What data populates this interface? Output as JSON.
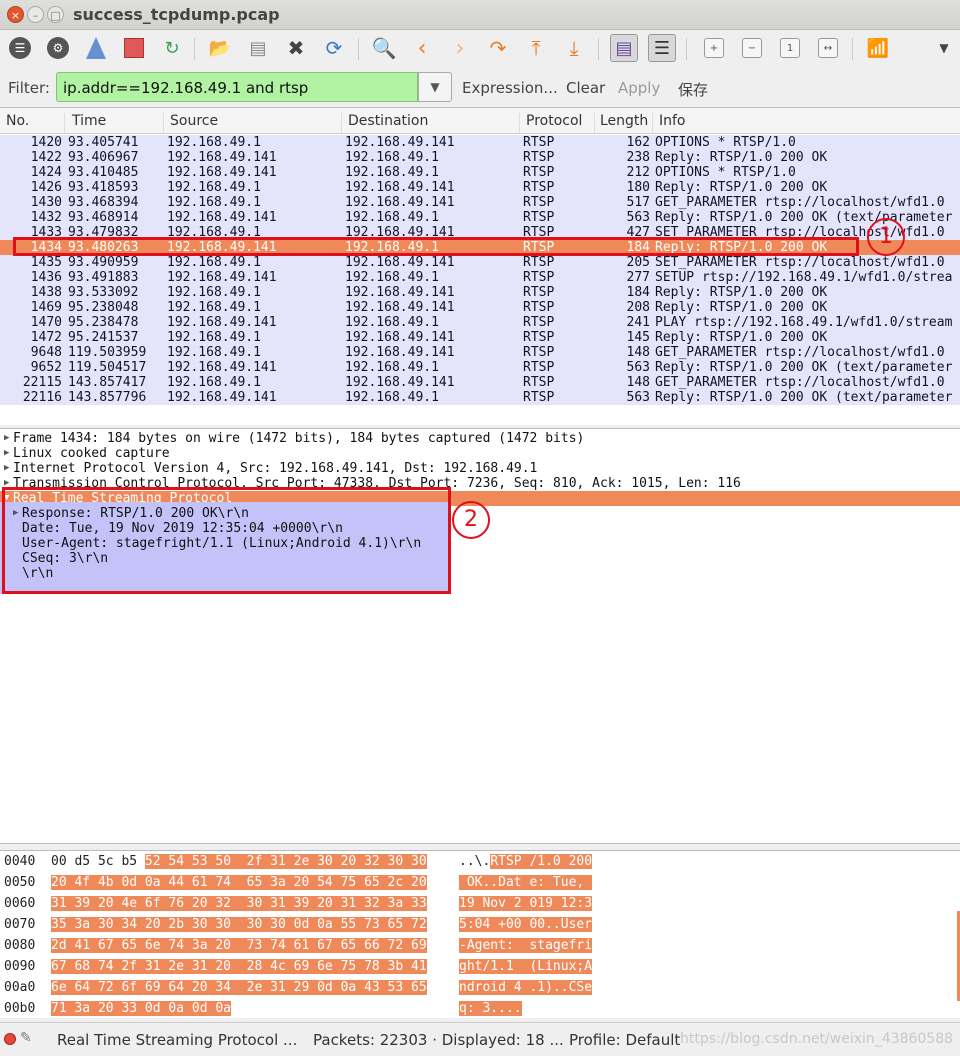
{
  "window": {
    "title": "success_tcpdump.pcap",
    "close_glyph": "×",
    "minimize_glyph": "–",
    "maximize_glyph": "□"
  },
  "toolbar": {
    "icons": [
      "interfaces-icon",
      "options-icon",
      "start-capture-icon",
      "stop-capture-icon",
      "restart-capture-icon",
      "open-file-icon",
      "save-file-icon",
      "close-file-icon",
      "reload-icon",
      "find-packet-icon",
      "go-back-icon",
      "go-forward-icon",
      "go-to-packet-icon",
      "first-packet-icon",
      "last-packet-icon",
      "colorize-icon",
      "auto-scroll-icon",
      "zoom-in-icon",
      "zoom-out-icon",
      "normal-size-icon",
      "resize-columns-icon",
      "wireless-icon",
      "more-icon"
    ]
  },
  "filter": {
    "label": "Filter:",
    "value": "ip.addr==192.168.49.1 and rtsp",
    "expression_label": "Expression...",
    "clear_label": "Clear",
    "apply_label": "Apply",
    "save_label": "保存"
  },
  "packet_list": {
    "columns": [
      "No.",
      "Time",
      "Source",
      "Destination",
      "Protocol",
      "Length",
      "Info"
    ],
    "rows": [
      {
        "no": "1420",
        "time": "93.405741",
        "src": "192.168.49.1",
        "dst": "192.168.49.141",
        "proto": "RTSP",
        "len": "162",
        "info": "OPTIONS * RTSP/1.0"
      },
      {
        "no": "1422",
        "time": "93.406967",
        "src": "192.168.49.141",
        "dst": "192.168.49.1",
        "proto": "RTSP",
        "len": "238",
        "info": "Reply: RTSP/1.0 200 OK"
      },
      {
        "no": "1424",
        "time": "93.410485",
        "src": "192.168.49.141",
        "dst": "192.168.49.1",
        "proto": "RTSP",
        "len": "212",
        "info": "OPTIONS * RTSP/1.0"
      },
      {
        "no": "1426",
        "time": "93.418593",
        "src": "192.168.49.1",
        "dst": "192.168.49.141",
        "proto": "RTSP",
        "len": "180",
        "info": "Reply: RTSP/1.0 200 OK"
      },
      {
        "no": "1430",
        "time": "93.468394",
        "src": "192.168.49.1",
        "dst": "192.168.49.141",
        "proto": "RTSP",
        "len": "517",
        "info": "GET_PARAMETER rtsp://localhost/wfd1.0"
      },
      {
        "no": "1432",
        "time": "93.468914",
        "src": "192.168.49.141",
        "dst": "192.168.49.1",
        "proto": "RTSP",
        "len": "563",
        "info": "Reply: RTSP/1.0 200 OK (text/parameter"
      },
      {
        "no": "1433",
        "time": "93.479832",
        "src": "192.168.49.1",
        "dst": "192.168.49.141",
        "proto": "RTSP",
        "len": "427",
        "info": "SET_PARAMETER rtsp://localhost/wfd1.0"
      },
      {
        "no": "1434",
        "time": "93.480263",
        "src": "192.168.49.141",
        "dst": "192.168.49.1",
        "proto": "RTSP",
        "len": "184",
        "info": "Reply: RTSP/1.0 200 OK",
        "selected": true
      },
      {
        "no": "1435",
        "time": "93.490959",
        "src": "192.168.49.1",
        "dst": "192.168.49.141",
        "proto": "RTSP",
        "len": "205",
        "info": "SET_PARAMETER rtsp://localhost/wfd1.0"
      },
      {
        "no": "1436",
        "time": "93.491883",
        "src": "192.168.49.141",
        "dst": "192.168.49.1",
        "proto": "RTSP",
        "len": "277",
        "info": "SETUP rtsp://192.168.49.1/wfd1.0/strea"
      },
      {
        "no": "1438",
        "time": "93.533092",
        "src": "192.168.49.1",
        "dst": "192.168.49.141",
        "proto": "RTSP",
        "len": "184",
        "info": "Reply: RTSP/1.0 200 OK"
      },
      {
        "no": "1469",
        "time": "95.238048",
        "src": "192.168.49.1",
        "dst": "192.168.49.141",
        "proto": "RTSP",
        "len": "208",
        "info": "Reply: RTSP/1.0 200 OK"
      },
      {
        "no": "1470",
        "time": "95.238478",
        "src": "192.168.49.141",
        "dst": "192.168.49.1",
        "proto": "RTSP",
        "len": "241",
        "info": "PLAY rtsp://192.168.49.1/wfd1.0/stream"
      },
      {
        "no": "1472",
        "time": "95.241537",
        "src": "192.168.49.1",
        "dst": "192.168.49.141",
        "proto": "RTSP",
        "len": "145",
        "info": "Reply: RTSP/1.0 200 OK"
      },
      {
        "no": "9648",
        "time": "119.503959",
        "src": "192.168.49.1",
        "dst": "192.168.49.141",
        "proto": "RTSP",
        "len": "148",
        "info": "GET_PARAMETER rtsp://localhost/wfd1.0"
      },
      {
        "no": "9652",
        "time": "119.504517",
        "src": "192.168.49.141",
        "dst": "192.168.49.1",
        "proto": "RTSP",
        "len": "563",
        "info": "Reply: RTSP/1.0 200 OK (text/parameter"
      },
      {
        "no": "22115",
        "time": "143.857417",
        "src": "192.168.49.1",
        "dst": "192.168.49.141",
        "proto": "RTSP",
        "len": "148",
        "info": "GET_PARAMETER rtsp://localhost/wfd1.0"
      },
      {
        "no": "22116",
        "time": "143.857796",
        "src": "192.168.49.141",
        "dst": "192.168.49.1",
        "proto": "RTSP",
        "len": "563",
        "info": "Reply: RTSP/1.0 200 OK (text/parameter"
      }
    ]
  },
  "annotations": {
    "marker_1": "1",
    "marker_2": "2",
    "color": "#e0101a"
  },
  "details": {
    "frame": "Frame 1434: 184 bytes on wire (1472 bits), 184 bytes captured (1472 bits)",
    "linux": "Linux cooked capture",
    "ip": "Internet Protocol Version 4, Src: 192.168.49.141, Dst: 192.168.49.1",
    "tcp": "Transmission Control Protocol, Src Port: 47338, Dst Port: 7236, Seq: 810, Ack: 1015, Len: 116",
    "rtsp": "Real Time Streaming Protocol",
    "rtsp_children": [
      "Response: RTSP/1.0 200 OK\\r\\n",
      "Date: Tue, 19 Nov 2019 12:35:04 +0000\\r\\n",
      "User-Agent: stagefright/1.1 (Linux;Android 4.1)\\r\\n",
      "CSeq: 3\\r\\n",
      "\\r\\n"
    ]
  },
  "hex": {
    "rows": [
      {
        "offset": "0040",
        "bytes_plain": "00 d5 5c b5 ",
        "bytes_hl": "52 54 53 50  2f 31 2e 30 20 32 30 30",
        "ascii_plain": "..\\.",
        "ascii_hl": "RTSP /1.0 200"
      },
      {
        "offset": "0050",
        "bytes_plain": "",
        "bytes_hl": "20 4f 4b 0d 0a 44 61 74  65 3a 20 54 75 65 2c 20",
        "ascii_plain": "",
        "ascii_hl": " OK..Dat e: Tue, "
      },
      {
        "offset": "0060",
        "bytes_plain": "",
        "bytes_hl": "31 39 20 4e 6f 76 20 32  30 31 39 20 31 32 3a 33",
        "ascii_plain": "",
        "ascii_hl": "19 Nov 2 019 12:3"
      },
      {
        "offset": "0070",
        "bytes_plain": "",
        "bytes_hl": "35 3a 30 34 20 2b 30 30  30 30 0d 0a 55 73 65 72",
        "ascii_plain": "",
        "ascii_hl": "5:04 +00 00..User"
      },
      {
        "offset": "0080",
        "bytes_plain": "",
        "bytes_hl": "2d 41 67 65 6e 74 3a 20  73 74 61 67 65 66 72 69",
        "ascii_plain": "",
        "ascii_hl": "-Agent:  stagefri"
      },
      {
        "offset": "0090",
        "bytes_plain": "",
        "bytes_hl": "67 68 74 2f 31 2e 31 20  28 4c 69 6e 75 78 3b 41",
        "ascii_plain": "",
        "ascii_hl": "ght/1.1  (Linux;A"
      },
      {
        "offset": "00a0",
        "bytes_plain": "",
        "bytes_hl": "6e 64 72 6f 69 64 20 34  2e 31 29 0d 0a 43 53 65",
        "ascii_plain": "",
        "ascii_hl": "ndroid 4 .1)..CSe"
      },
      {
        "offset": "00b0",
        "bytes_plain": "",
        "bytes_hl": "71 3a 20 33 0d 0a 0d 0a",
        "ascii_plain": "",
        "ascii_hl": "q: 3...."
      }
    ]
  },
  "status": {
    "protocol": "Real Time Streaming Protocol ...",
    "packets": "Packets: 22303 · Displayed: 18 ...",
    "profile": "Profile: Default",
    "watermark": "https://blog.csdn.net/weixin_43860588"
  },
  "colors": {
    "row_bg": "#e4e4fb",
    "selected_bg": "#f0895a",
    "filter_valid": "#b1f3a2",
    "rtsp_child_bg": "#c3c3fa"
  }
}
